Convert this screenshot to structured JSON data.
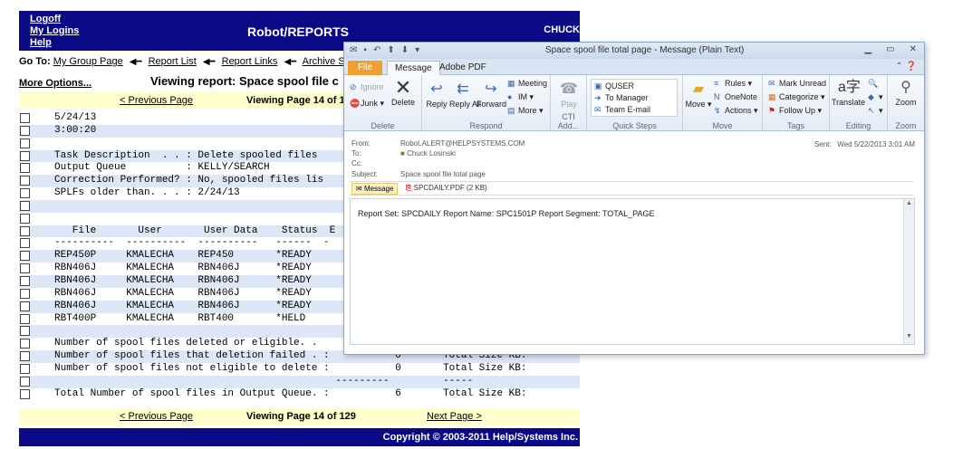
{
  "robot": {
    "header_links": [
      "Logoff",
      "My Logins",
      "Help"
    ],
    "app_title": "Robot/REPORTS",
    "user": "CHUCK",
    "goto": {
      "label": "Go To:",
      "links": [
        "My Group Page",
        "Report List",
        "Report Links",
        "Archive Stat"
      ]
    },
    "more_options": "More Options...",
    "viewing_report": "Viewing report: Space spool file c",
    "pager_top": {
      "prev": "< Previous Page",
      "middle": "Viewing Page 14 of 1"
    },
    "pager_bottom": {
      "prev": "< Previous Page",
      "middle": "Viewing Page 14 of 129",
      "next": "Next Page >"
    },
    "report_lines": [
      "5/24/13                                          Sto",
      "3:00:20",
      "",
      "Task Description  . . : Delete spooled files",
      "Output Queue          : KELLY/SEARCH",
      "Correction Performed? : No, spooled files lis",
      "SPLFs older than. . . : 2/24/13",
      "",
      "",
      "   File       User       User Data    Status  E",
      "----------  ----------  ----------   ------  -",
      "REP450P     KMALECHA    REP450       *READY",
      "RBN406J     KMALECHA    RBN406J      *READY",
      "RBN406J     KMALECHA    RBN406J      *READY",
      "RBN406J     KMALECHA    RBN406J      *READY",
      "RBN406J     KMALECHA    RBN406J      *READY",
      "RBT400P     KMALECHA    RBT400       *HELD",
      "",
      "Number of spool files deleted or eligible. .",
      "Number of spool files that deletion failed . :           0       Total Size KB:",
      "Number of spool files not eligible to delete :           0       Total Size KB:",
      "                                               ---------         -----",
      "Total Number of spool files in Output Queue. :           6       Total Size KB:"
    ],
    "copyright": "Copyright © 2003-2011 Help/Systems Inc."
  },
  "outlook": {
    "window_title": "Space spool file total page - Message (Plain Text)",
    "tabs": [
      "File",
      "Message",
      "Adobe PDF"
    ],
    "ribbon": {
      "delete": {
        "ignore": "Ignore",
        "junk": "Junk",
        "delete": "Delete",
        "group": "Delete"
      },
      "respond": {
        "reply": "Reply",
        "reply_all": "Reply All",
        "forward": "Forward",
        "meeting": "Meeting",
        "im": "IM",
        "more": "More",
        "group": "Respond"
      },
      "cti": {
        "play": "Play",
        "group": "CTI Add..."
      },
      "quick_steps": {
        "items": [
          "QUSER",
          "To Manager",
          "Team E-mail"
        ],
        "group": "Quick Steps"
      },
      "move": {
        "move": "Move",
        "rules": "Rules",
        "onenote": "OneNote",
        "actions": "Actions",
        "group": "Move"
      },
      "tags": {
        "mark_unread": "Mark Unread",
        "categorize": "Categorize",
        "follow_up": "Follow Up",
        "group": "Tags"
      },
      "editing": {
        "translate": "Translate",
        "group": "Editing"
      },
      "zoom": {
        "zoom": "Zoom",
        "group": "Zoom"
      }
    },
    "header": {
      "from_label": "From:",
      "from": "Robot.ALERT@HELPSYSTEMS.COM",
      "to_label": "To:",
      "to": "Chuck Losinski",
      "cc_label": "Cc:",
      "subject_label": "Subject:",
      "subject": "Space spool file total page",
      "sent_label": "Sent:",
      "sent": "Wed 5/22/2013 3:01 AM"
    },
    "attachments": {
      "message": "Message",
      "pdf": "SPCDAILY.PDF (2 KB)"
    },
    "body": "Report Set: SPCDAILY Report Name: SPC1501P Report Segment: TOTAL_PAGE"
  }
}
